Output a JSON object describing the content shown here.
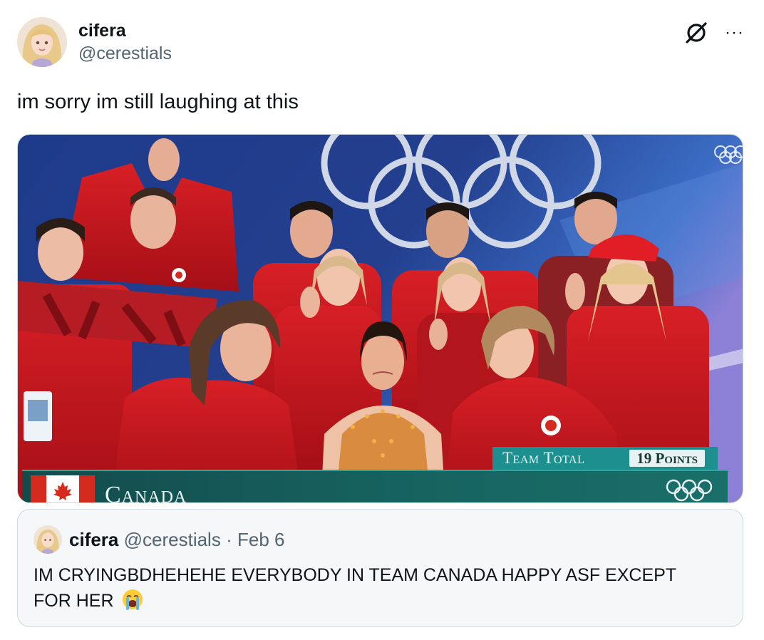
{
  "author": {
    "display_name": "cifera",
    "handle": "@cerestials"
  },
  "header_icons": [
    "grok-icon",
    "more-icon"
  ],
  "more_label": "···",
  "tweet": {
    "text": "im sorry im still laughing at this"
  },
  "media": {
    "overlay": {
      "team_total_label": "Team Total",
      "points": "19 Points",
      "country": "Canada"
    },
    "colors": {
      "backdrop_blue": "#213a86",
      "jacket_red": "#c8161d",
      "overlay_teal": "#1d8f8f"
    }
  },
  "quoted_tweet": {
    "display_name": "cifera",
    "handle": "@cerestials",
    "separator": "·",
    "date": "Feb 6",
    "text": "IM CRYINGBDHEHEHE EVERYBODY IN TEAM CANADA HAPPY ASF EXCEPT FOR HER",
    "emoji": "loudly-crying-face"
  }
}
